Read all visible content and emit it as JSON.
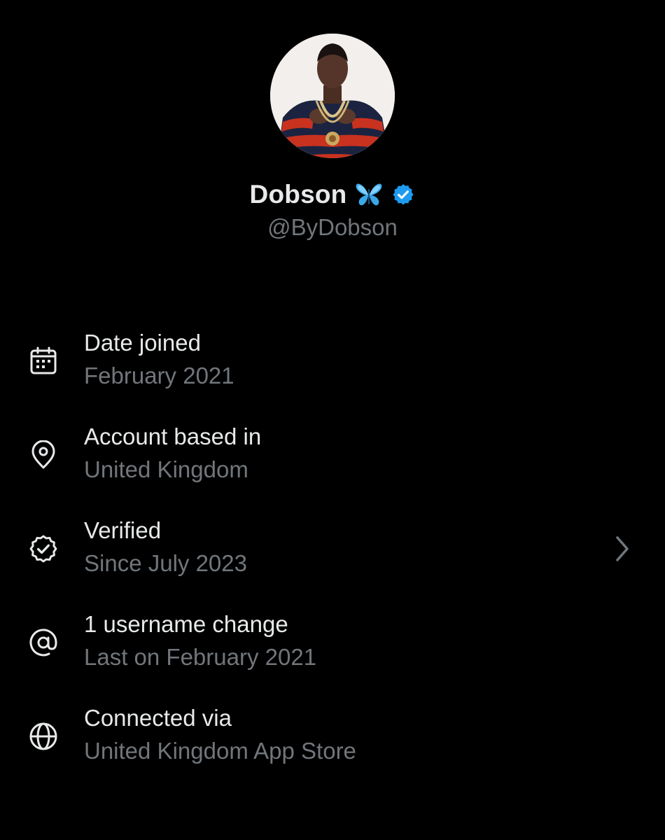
{
  "profile": {
    "display_name": "Dobson",
    "handle": "@ByDobson",
    "name_emoji": "butterfly",
    "verified": true,
    "verified_color": "#1d9bf0",
    "avatar_alt": "profile photo"
  },
  "about_items": [
    {
      "icon": "calendar-icon",
      "title": "Date joined",
      "subtitle": "February 2021"
    },
    {
      "icon": "location-pin-icon",
      "title": "Account based in",
      "subtitle": "United Kingdom"
    },
    {
      "icon": "verified-check-icon",
      "title": "Verified",
      "subtitle": "Since July 2023",
      "has_chevron": true
    },
    {
      "icon": "at-sign-icon",
      "title": "1 username change",
      "subtitle": "Last on February 2021"
    },
    {
      "icon": "globe-icon",
      "title": "Connected via",
      "subtitle": "United Kingdom App Store"
    }
  ],
  "colors": {
    "background": "#000000",
    "primary_text": "#e7e9ea",
    "secondary_text": "#71767b",
    "accent": "#1d9bf0"
  }
}
